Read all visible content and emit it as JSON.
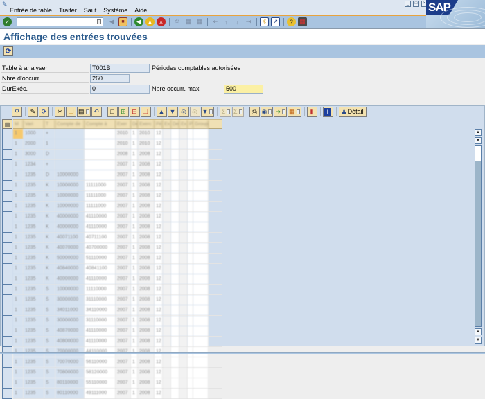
{
  "window": {
    "menu": [
      {
        "label": "Entrée de table",
        "accel": "E"
      },
      {
        "label": "Traiter",
        "accel": "T"
      },
      {
        "label": "Saut",
        "accel": ""
      },
      {
        "label": "Système",
        "accel": "y"
      },
      {
        "label": "Aide",
        "accel": "A"
      }
    ],
    "logo_text": "SAP",
    "window_buttons": [
      "minimize",
      "restore",
      "close"
    ]
  },
  "toolbar": {
    "command_field_value": "",
    "icons": [
      "enter-icon",
      "back-arrow-icon",
      "save-icon",
      "back-icon",
      "exit-icon",
      "cancel-icon",
      "print-icon",
      "find-icon",
      "find-next-icon",
      "first-page-icon",
      "previous-page-icon",
      "next-page-icon",
      "last-page-icon",
      "create-session-icon",
      "shortcut-icon",
      "help-icon",
      "layout-icon"
    ]
  },
  "screen": {
    "title": "Affichage des entrées trouvées",
    "refresh_label": "Actualiser"
  },
  "form": {
    "table_label": "Table à analyser",
    "table_value": "T001B",
    "table_description": "Périodes comptables autorisées",
    "count_label": "Nbre d'occurr.",
    "count_value": "260",
    "runtime_label": "DurExéc.",
    "runtime_value": "0",
    "max_label": "Nbre occurr. maxi",
    "max_value": "500"
  },
  "grid": {
    "toolbar": {
      "detail_label": "Détail"
    },
    "columns": [
      "M",
      "Vari",
      "T",
      "Compte de",
      "Compte à",
      "Exer",
      "De",
      "Exerc",
      "Pé",
      "Ex",
      "De",
      "Ex",
      "Pé",
      "Groupe"
    ],
    "rows": [
      [
        "1",
        "1000",
        "+",
        "",
        "",
        "2010",
        "1",
        "2010",
        "12",
        "",
        "",
        "",
        "",
        ""
      ],
      [
        "1",
        "2000",
        "1",
        "",
        "",
        "2010",
        "1",
        "2010",
        "12",
        "",
        "",
        "",
        "",
        ""
      ],
      [
        "1",
        "3000",
        "D",
        "",
        "",
        "2008",
        "1",
        "2008",
        "12",
        "",
        "",
        "",
        "",
        ""
      ],
      [
        "1",
        "1234",
        "+",
        "",
        "",
        "2007",
        "1",
        "2008",
        "12",
        "",
        "",
        "",
        "",
        ""
      ],
      [
        "1",
        "1235",
        "D",
        "10000000",
        "",
        "2007",
        "1",
        "2008",
        "12",
        "",
        "",
        "",
        "",
        ""
      ],
      [
        "1",
        "1235",
        "K",
        "10000000",
        "11111000",
        "2007",
        "1",
        "2008",
        "12",
        "",
        "",
        "",
        "",
        ""
      ],
      [
        "1",
        "1235",
        "K",
        "10000000",
        "11111000",
        "2007",
        "1",
        "2008",
        "12",
        "",
        "",
        "",
        "",
        ""
      ],
      [
        "1",
        "1235",
        "K",
        "10000000",
        "11111000",
        "2007",
        "1",
        "2008",
        "12",
        "",
        "",
        "",
        "",
        ""
      ],
      [
        "1",
        "1235",
        "K",
        "40000000",
        "41110000",
        "2007",
        "1",
        "2008",
        "12",
        "",
        "",
        "",
        "",
        ""
      ],
      [
        "1",
        "1235",
        "K",
        "40000000",
        "41110000",
        "2007",
        "1",
        "2008",
        "12",
        "",
        "",
        "",
        "",
        ""
      ],
      [
        "1",
        "1235",
        "K",
        "40071100",
        "40711100",
        "2007",
        "1",
        "2008",
        "12",
        "",
        "",
        "",
        "",
        ""
      ],
      [
        "1",
        "1235",
        "K",
        "40070000",
        "40700000",
        "2007",
        "1",
        "2008",
        "12",
        "",
        "",
        "",
        "",
        ""
      ],
      [
        "1",
        "1235",
        "K",
        "50000000",
        "51110000",
        "2007",
        "1",
        "2008",
        "12",
        "",
        "",
        "",
        "",
        ""
      ],
      [
        "1",
        "1235",
        "K",
        "40840000",
        "40841100",
        "2007",
        "1",
        "2008",
        "12",
        "",
        "",
        "",
        "",
        ""
      ],
      [
        "1",
        "1235",
        "K",
        "40000000",
        "41110000",
        "2007",
        "1",
        "2008",
        "12",
        "",
        "",
        "",
        "",
        ""
      ],
      [
        "1",
        "1235",
        "S",
        "10000000",
        "11110000",
        "2007",
        "1",
        "2008",
        "12",
        "",
        "",
        "",
        "",
        ""
      ],
      [
        "1",
        "1235",
        "S",
        "30000000",
        "31110000",
        "2007",
        "1",
        "2008",
        "12",
        "",
        "",
        "",
        "",
        ""
      ],
      [
        "1",
        "1235",
        "S",
        "34011000",
        "34110000",
        "2007",
        "1",
        "2008",
        "12",
        "",
        "",
        "",
        "",
        ""
      ],
      [
        "1",
        "1235",
        "S",
        "30000000",
        "31110000",
        "2007",
        "1",
        "2008",
        "12",
        "",
        "",
        "",
        "",
        ""
      ],
      [
        "1",
        "1235",
        "S",
        "40870000",
        "41110000",
        "2007",
        "1",
        "2008",
        "12",
        "",
        "",
        "",
        "",
        ""
      ],
      [
        "1",
        "1235",
        "S",
        "40800000",
        "41110000",
        "2007",
        "1",
        "2008",
        "12",
        "",
        "",
        "",
        "",
        ""
      ],
      [
        "1",
        "1235",
        "S",
        "70000000",
        "44110000",
        "2007",
        "1",
        "2008",
        "12",
        "",
        "",
        "",
        "",
        ""
      ],
      [
        "1",
        "1235",
        "S",
        "70070000",
        "56110000",
        "2007",
        "1",
        "2008",
        "12",
        "",
        "",
        "",
        "",
        ""
      ],
      [
        "1",
        "1235",
        "S",
        "70800000",
        "58120000",
        "2007",
        "1",
        "2008",
        "12",
        "",
        "",
        "",
        "",
        ""
      ],
      [
        "1",
        "1235",
        "S",
        "80110000",
        "55110000",
        "2007",
        "1",
        "2008",
        "12",
        "",
        "",
        "",
        "",
        ""
      ],
      [
        "1",
        "1235",
        "S",
        "80110000",
        "49111000",
        "2007",
        "1",
        "2008",
        "12",
        "",
        "",
        "",
        "",
        ""
      ]
    ]
  }
}
